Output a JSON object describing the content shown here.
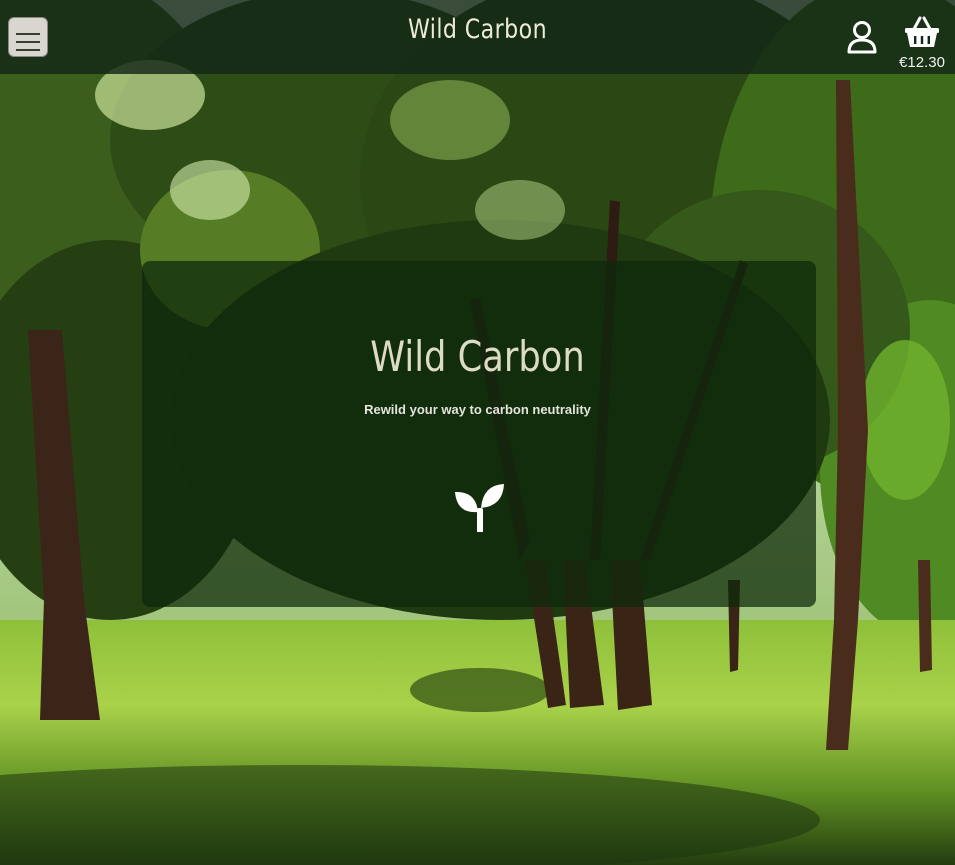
{
  "navbar": {
    "brand": "Wild Carbon",
    "menu_icon": "hamburger-menu-icon",
    "account_icon": "user-icon",
    "basket_icon": "shopping-basket-icon",
    "basket_total": "€12.30"
  },
  "hero": {
    "title": "Wild Carbon",
    "subtitle": "Rewild your way to carbon neutrality",
    "icon": "seedling-icon"
  },
  "background": {
    "subject": "forest",
    "accent_color": "#0c280a"
  }
}
